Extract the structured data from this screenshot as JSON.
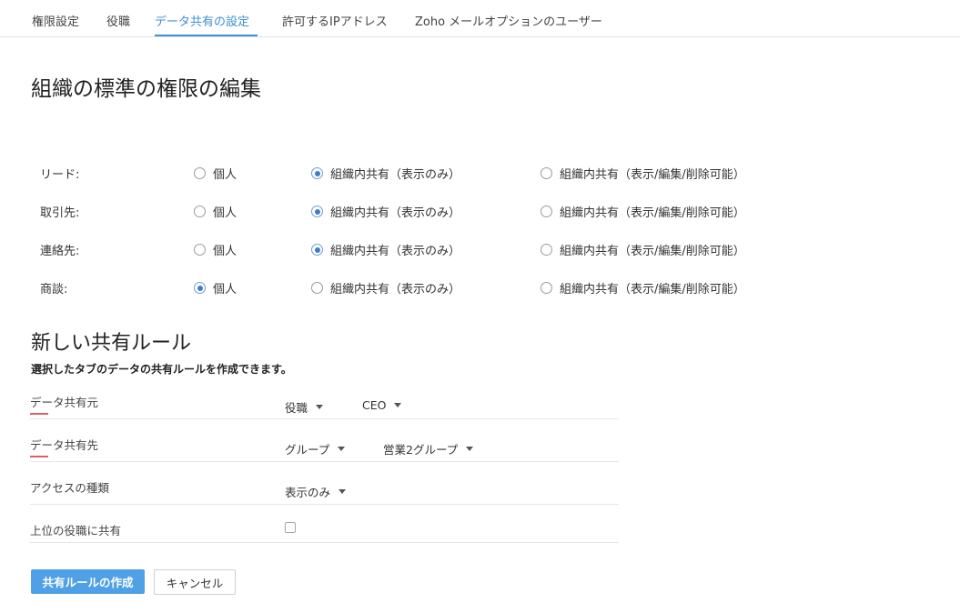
{
  "tabs": [
    {
      "label": "権限設定",
      "active": false
    },
    {
      "label": "役職",
      "active": false
    },
    {
      "label": "データ共有の設定",
      "active": true
    },
    {
      "label": "許可するIPアドレス",
      "active": false
    },
    {
      "label": "Zoho メールオプションのユーザー",
      "active": false
    }
  ],
  "page_title": "組織の標準の権限の編集",
  "permission_options": {
    "private": "個人",
    "public_read": "組織内共有（表示のみ）",
    "public_read_write": "組織内共有（表示/編集/削除可能）"
  },
  "permissions": [
    {
      "label": "リード:",
      "selected": "public_read"
    },
    {
      "label": "取引先:",
      "selected": "public_read"
    },
    {
      "label": "連絡先:",
      "selected": "public_read"
    },
    {
      "label": "商談:",
      "selected": "private"
    }
  ],
  "sharing_rule": {
    "title": "新しい共有ルール",
    "subtitle": "選択したタブのデータの共有ルールを作成できます。",
    "source_label": "データ共有元",
    "source_type": "役職",
    "source_value": "CEO",
    "target_label": "データ共有先",
    "target_type": "グループ",
    "target_value": "営業2グループ",
    "access_label": "アクセスの種類",
    "access_value": "表示のみ",
    "superior_label": "上位の役職に共有",
    "superior_checked": false
  },
  "buttons": {
    "create": "共有ルールの作成",
    "cancel": "キャンセル"
  },
  "colors": {
    "accent": "#3d8fd6",
    "primary_button": "#4fa0e6",
    "required_mark": "#e06060"
  }
}
